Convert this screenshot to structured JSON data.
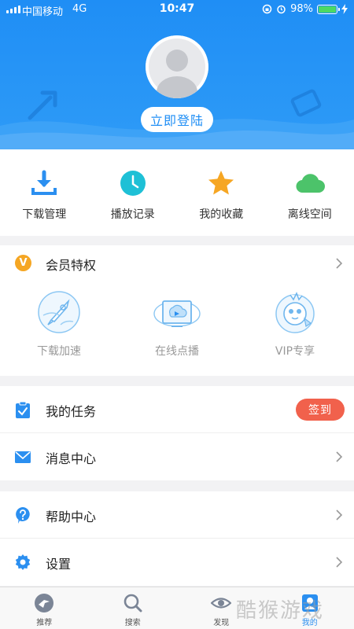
{
  "status_bar": {
    "carrier": "中国移动",
    "network": "4G",
    "time": "10:47",
    "battery": "98%",
    "battery_level": 0.98
  },
  "header": {
    "login_label": "立即登陆",
    "avatar_icon": "default-avatar-icon",
    "background_color": "#1f8ef5"
  },
  "quick_actions": [
    {
      "label": "下载管理",
      "icon": "download-icon",
      "color": "#2b8ff0"
    },
    {
      "label": "播放记录",
      "icon": "clock-icon",
      "color": "#1ec0d6"
    },
    {
      "label": "我的收藏",
      "icon": "star-icon",
      "color": "#f6a623"
    },
    {
      "label": "离线空间",
      "icon": "cloud-icon",
      "color": "#4cc36a"
    }
  ],
  "vip": {
    "badge": "V",
    "title": "会员特权",
    "items": [
      {
        "label": "下载加速",
        "icon": "rocket-icon"
      },
      {
        "label": "在线点播",
        "icon": "video-screen-icon"
      },
      {
        "label": "VIP专享",
        "icon": "mascot-icon"
      }
    ]
  },
  "list_group_1": [
    {
      "label": "我的任务",
      "icon": "clipboard-check-icon",
      "action": "签到"
    },
    {
      "label": "消息中心",
      "icon": "envelope-icon"
    }
  ],
  "list_group_2": [
    {
      "label": "帮助中心",
      "icon": "help-bubble-icon"
    },
    {
      "label": "设置",
      "icon": "gear-icon"
    }
  ],
  "tabbar": [
    {
      "label": "推荐",
      "icon": "bird-icon"
    },
    {
      "label": "搜索",
      "icon": "search-icon"
    },
    {
      "label": "发现",
      "icon": "eye-icon"
    },
    {
      "label": "我的",
      "icon": "profile-icon",
      "active": true
    }
  ],
  "watermark": "酷猴游戏",
  "accent_color": "#2b8ff0",
  "checkin_color": "#f1614c"
}
